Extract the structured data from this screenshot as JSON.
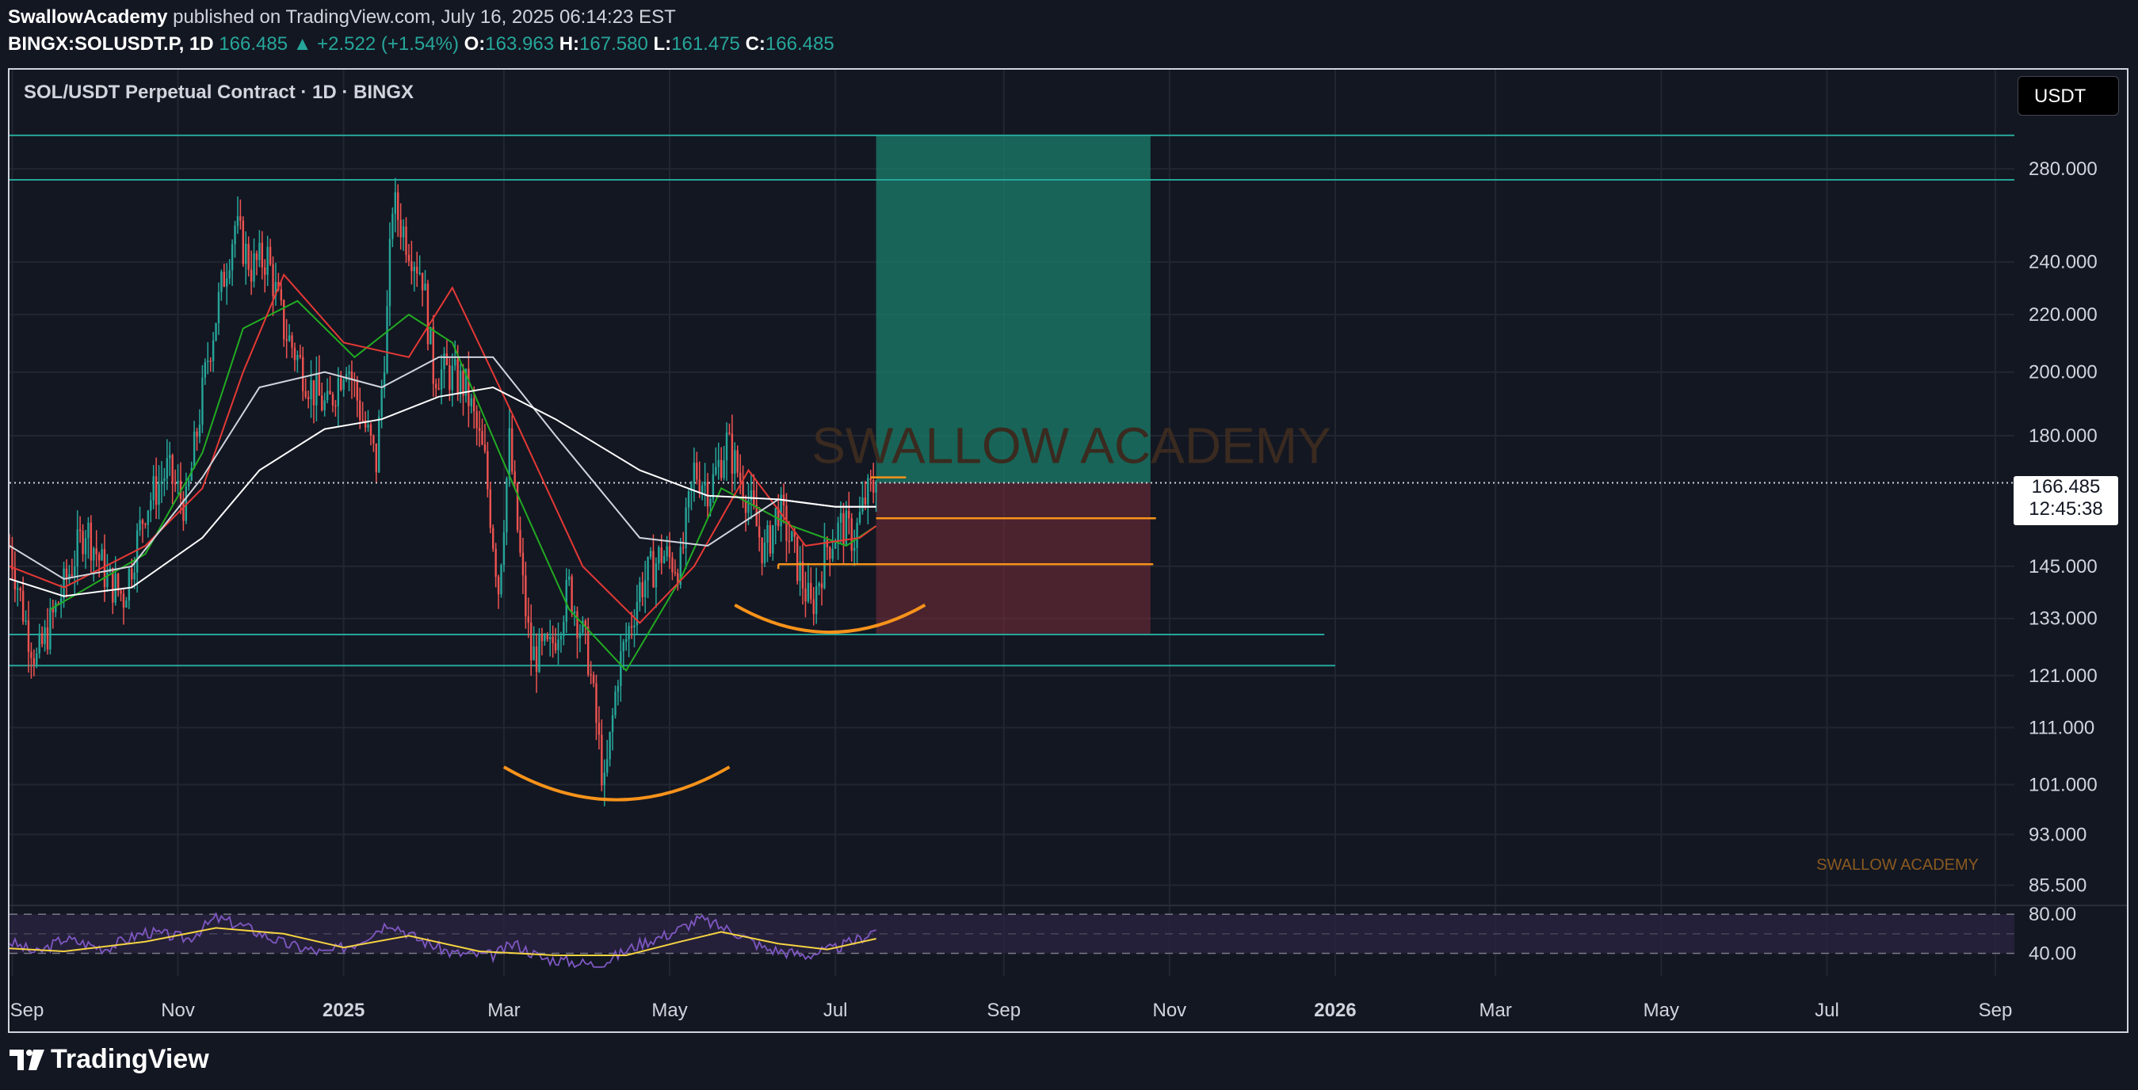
{
  "header": {
    "author": "SwallowAcademy",
    "published": "published on TradingView.com, July 16, 2025 06:14:23 EST",
    "symbol": "BINGX:SOLUSDT.P, 1D",
    "last": "166.485",
    "change": "▲ +2.522 (+1.54%)",
    "open_label": "O:",
    "open": "163.963",
    "high_label": "H:",
    "high": "167.580",
    "low_label": "L:",
    "low": "161.475",
    "close_label": "C:",
    "close": "166.485"
  },
  "currency": "USDT",
  "last_price_box": {
    "price": "166.485",
    "countdown": "12:45:38"
  },
  "footer": {
    "brand": "TradingView",
    "logo_icon": "tradingview-logo-icon"
  },
  "chart_data": {
    "type": "candlestick",
    "title": "SOL/USDT Perpetual Contract · 1D · BINGX",
    "watermark": "SWALLOW ACADEMY",
    "watermark_small": "SWALLOW ACADEMY",
    "y_scale": "log",
    "ylim": [
      84,
      330
    ],
    "y_ticks": [
      "280.000",
      "240.000",
      "220.000",
      "200.000",
      "180.000",
      "145.000",
      "133.000",
      "121.000",
      "111.000",
      "101.000",
      "93.000",
      "85.500"
    ],
    "y_tick_values": [
      280,
      240,
      220,
      200,
      180,
      145,
      133,
      121,
      111,
      101,
      93,
      85.5
    ],
    "x_ticks": [
      "Sep",
      "Nov",
      "2025",
      "Mar",
      "May",
      "Jul",
      "Sep",
      "Nov",
      "2026",
      "Mar",
      "May",
      "Jul",
      "Sep"
    ],
    "x_tick_dates": [
      "2024-09-01",
      "2024-11-01",
      "2025-01-01",
      "2025-03-01",
      "2025-05-01",
      "2025-07-01",
      "2025-09-01",
      "2025-11-01",
      "2026-01-01",
      "2026-03-01",
      "2026-05-01",
      "2026-07-01",
      "2026-09-01"
    ],
    "date_range": [
      "2024-08-31",
      "2026-09-08"
    ],
    "last_price": 166.485,
    "price_path": [
      [
        "2024-08-31",
        150
      ],
      [
        "2024-09-06",
        132
      ],
      [
        "2024-09-10",
        124
      ],
      [
        "2024-09-20",
        140
      ],
      [
        "2024-09-28",
        155
      ],
      [
        "2024-10-06",
        142
      ],
      [
        "2024-10-12",
        138
      ],
      [
        "2024-10-20",
        160
      ],
      [
        "2024-10-28",
        170
      ],
      [
        "2024-11-04",
        160
      ],
      [
        "2024-11-12",
        205
      ],
      [
        "2024-11-18",
        235
      ],
      [
        "2024-11-22",
        255
      ],
      [
        "2024-11-28",
        238
      ],
      [
        "2024-12-04",
        242
      ],
      [
        "2024-12-10",
        215
      ],
      [
        "2024-12-20",
        195
      ],
      [
        "2024-12-26",
        188
      ],
      [
        "2025-01-02",
        205
      ],
      [
        "2025-01-07",
        188
      ],
      [
        "2025-01-13",
        172
      ],
      [
        "2025-01-17",
        220
      ],
      [
        "2025-01-19",
        265
      ],
      [
        "2025-01-24",
        250
      ],
      [
        "2025-01-30",
        235
      ],
      [
        "2025-02-03",
        200
      ],
      [
        "2025-02-08",
        200
      ],
      [
        "2025-02-15",
        195
      ],
      [
        "2025-02-22",
        172
      ],
      [
        "2025-02-27",
        140
      ],
      [
        "2025-03-03",
        178
      ],
      [
        "2025-03-08",
        140
      ],
      [
        "2025-03-11",
        125
      ],
      [
        "2025-03-18",
        126
      ],
      [
        "2025-03-25",
        140
      ],
      [
        "2025-04-01",
        125
      ],
      [
        "2025-04-07",
        100
      ],
      [
        "2025-04-12",
        122
      ],
      [
        "2025-04-20",
        140
      ],
      [
        "2025-04-28",
        148
      ],
      [
        "2025-05-05",
        145
      ],
      [
        "2025-05-10",
        170
      ],
      [
        "2025-05-16",
        165
      ],
      [
        "2025-05-22",
        178
      ],
      [
        "2025-05-30",
        162
      ],
      [
        "2025-06-05",
        148
      ],
      [
        "2025-06-10",
        160
      ],
      [
        "2025-06-15",
        150
      ],
      [
        "2025-06-22",
        135
      ],
      [
        "2025-06-28",
        150
      ],
      [
        "2025-07-03",
        155
      ],
      [
        "2025-07-08",
        152
      ],
      [
        "2025-07-12",
        162
      ],
      [
        "2025-07-16",
        166.485
      ]
    ],
    "moving_averages": [
      {
        "color": "#22ab22",
        "points": [
          [
            "2024-09-15",
            135
          ],
          [
            "2024-10-20",
            148
          ],
          [
            "2024-11-10",
            175
          ],
          [
            "2024-11-25",
            215
          ],
          [
            "2024-12-15",
            225
          ],
          [
            "2025-01-05",
            205
          ],
          [
            "2025-01-25",
            220
          ],
          [
            "2025-02-10",
            210
          ],
          [
            "2025-03-05",
            165
          ],
          [
            "2025-03-25",
            135
          ],
          [
            "2025-04-15",
            122
          ],
          [
            "2025-05-05",
            142
          ],
          [
            "2025-05-20",
            165
          ],
          [
            "2025-06-15",
            155
          ],
          [
            "2025-07-05",
            150
          ],
          [
            "2025-07-16",
            155
          ]
        ]
      },
      {
        "color": "#e53935",
        "points": [
          [
            "2024-08-31",
            145
          ],
          [
            "2024-09-20",
            140
          ],
          [
            "2024-10-20",
            150
          ],
          [
            "2024-11-10",
            165
          ],
          [
            "2024-11-25",
            200
          ],
          [
            "2024-12-10",
            235
          ],
          [
            "2025-01-01",
            210
          ],
          [
            "2025-01-25",
            205
          ],
          [
            "2025-02-10",
            230
          ],
          [
            "2025-03-05",
            185
          ],
          [
            "2025-03-30",
            145
          ],
          [
            "2025-04-20",
            132
          ],
          [
            "2025-05-10",
            145
          ],
          [
            "2025-05-30",
            170
          ],
          [
            "2025-06-20",
            150
          ],
          [
            "2025-07-10",
            152
          ],
          [
            "2025-07-16",
            155
          ]
        ]
      },
      {
        "color": "#d1d4dc",
        "points": [
          [
            "2024-08-31",
            150
          ],
          [
            "2024-09-20",
            142
          ],
          [
            "2024-10-15",
            145
          ],
          [
            "2024-11-10",
            168
          ],
          [
            "2024-12-01",
            195
          ],
          [
            "2024-12-25",
            200
          ],
          [
            "2025-01-15",
            195
          ],
          [
            "2025-02-05",
            205
          ],
          [
            "2025-02-25",
            205
          ],
          [
            "2025-03-20",
            180
          ],
          [
            "2025-04-20",
            152
          ],
          [
            "2025-05-15",
            150
          ],
          [
            "2025-06-10",
            162
          ],
          [
            "2025-07-01",
            160
          ],
          [
            "2025-07-16",
            160
          ]
        ]
      },
      {
        "color": "#ffffff",
        "points": [
          [
            "2024-08-31",
            142
          ],
          [
            "2024-09-20",
            138
          ],
          [
            "2024-10-15",
            140
          ],
          [
            "2024-11-10",
            152
          ],
          [
            "2024-12-01",
            170
          ],
          [
            "2024-12-25",
            182
          ],
          [
            "2025-01-15",
            185
          ],
          [
            "2025-02-05",
            192
          ],
          [
            "2025-02-25",
            195
          ],
          [
            "2025-03-20",
            185
          ],
          [
            "2025-04-20",
            170
          ],
          [
            "2025-05-15",
            163
          ],
          [
            "2025-06-10",
            162
          ],
          [
            "2025-07-01",
            160
          ],
          [
            "2025-07-16",
            160
          ]
        ]
      }
    ],
    "rsi": {
      "levels": [
        80,
        40
      ],
      "ylim": [
        25,
        85
      ],
      "rsi_color": "#7e57c2",
      "signal_color": "#f5d442",
      "rsi_points": [
        [
          "2024-08-31",
          52
        ],
        [
          "2024-09-10",
          40
        ],
        [
          "2024-09-20",
          55
        ],
        [
          "2024-10-05",
          45
        ],
        [
          "2024-10-20",
          62
        ],
        [
          "2024-11-05",
          55
        ],
        [
          "2024-11-15",
          76
        ],
        [
          "2024-11-25",
          68
        ],
        [
          "2024-12-10",
          50
        ],
        [
          "2024-12-25",
          40
        ],
        [
          "2025-01-05",
          50
        ],
        [
          "2025-01-18",
          72
        ],
        [
          "2025-01-28",
          55
        ],
        [
          "2025-02-10",
          40
        ],
        [
          "2025-02-25",
          38
        ],
        [
          "2025-03-05",
          50
        ],
        [
          "2025-03-15",
          35
        ],
        [
          "2025-04-05",
          28
        ],
        [
          "2025-04-20",
          50
        ],
        [
          "2025-05-01",
          60
        ],
        [
          "2025-05-12",
          75
        ],
        [
          "2025-05-25",
          62
        ],
        [
          "2025-06-05",
          45
        ],
        [
          "2025-06-20",
          38
        ],
        [
          "2025-07-01",
          45
        ],
        [
          "2025-07-10",
          55
        ],
        [
          "2025-07-16",
          65
        ]
      ],
      "signal_points": [
        [
          "2024-08-31",
          45
        ],
        [
          "2024-09-20",
          42
        ],
        [
          "2024-10-20",
          52
        ],
        [
          "2024-11-15",
          66
        ],
        [
          "2024-12-10",
          60
        ],
        [
          "2025-01-01",
          46
        ],
        [
          "2025-01-25",
          58
        ],
        [
          "2025-02-20",
          42
        ],
        [
          "2025-03-20",
          38
        ],
        [
          "2025-04-15",
          38
        ],
        [
          "2025-05-05",
          52
        ],
        [
          "2025-05-20",
          62
        ],
        [
          "2025-06-10",
          50
        ],
        [
          "2025-06-28",
          44
        ],
        [
          "2025-07-16",
          55
        ]
      ]
    },
    "levels": [
      {
        "kind": "resistance",
        "value": 296,
        "from": "2024-08-31",
        "to": "2026-09-08",
        "color": "#26a69a"
      },
      {
        "kind": "resistance",
        "value": 275,
        "from": "2024-08-31",
        "to": "2026-09-08",
        "color": "#26a69a"
      },
      {
        "kind": "support",
        "value": 129.5,
        "from": "2024-08-31",
        "to": "2025-12-28",
        "color": "#26a69a"
      },
      {
        "kind": "support",
        "value": 123,
        "from": "2024-08-31",
        "to": "2026-01-01",
        "color": "#26a69a"
      }
    ],
    "position": {
      "start": "2025-07-16",
      "end": "2025-10-25",
      "entry": 166.485,
      "target": 296,
      "stop": 129.5,
      "profit_color": "#1b7f6b",
      "loss_color": "#7a2e3a"
    },
    "orange_lines": [
      {
        "value": 168,
        "from": "2025-07-14",
        "to": "2025-07-27"
      },
      {
        "value": 157,
        "from": "2025-07-16",
        "to": "2025-10-27"
      },
      {
        "value": 145.5,
        "from": "2025-06-10",
        "to": "2025-10-26"
      }
    ],
    "arcs": [
      {
        "from": "2025-03-01",
        "to": "2025-05-23",
        "bottom": 98.5,
        "edge": 104
      },
      {
        "from": "2025-05-25",
        "to": "2025-08-03",
        "bottom": 130,
        "edge": 136
      }
    ]
  }
}
